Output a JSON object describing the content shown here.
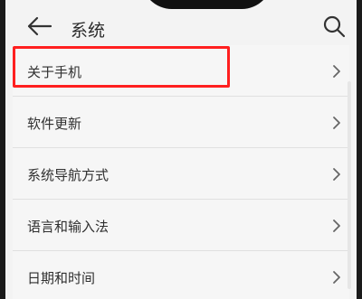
{
  "header": {
    "title": "系统",
    "back_icon": "arrow-left-icon",
    "search_icon": "search-icon"
  },
  "settings_items": [
    {
      "label": "关于手机",
      "highlighted": true
    },
    {
      "label": "软件更新"
    },
    {
      "label": "系统导航方式"
    },
    {
      "label": "语言和输入法"
    },
    {
      "label": "日期和时间"
    }
  ],
  "colors": {
    "highlight_box": "#ff1f1f",
    "background": "#f3f3f3",
    "text": "#303030"
  }
}
